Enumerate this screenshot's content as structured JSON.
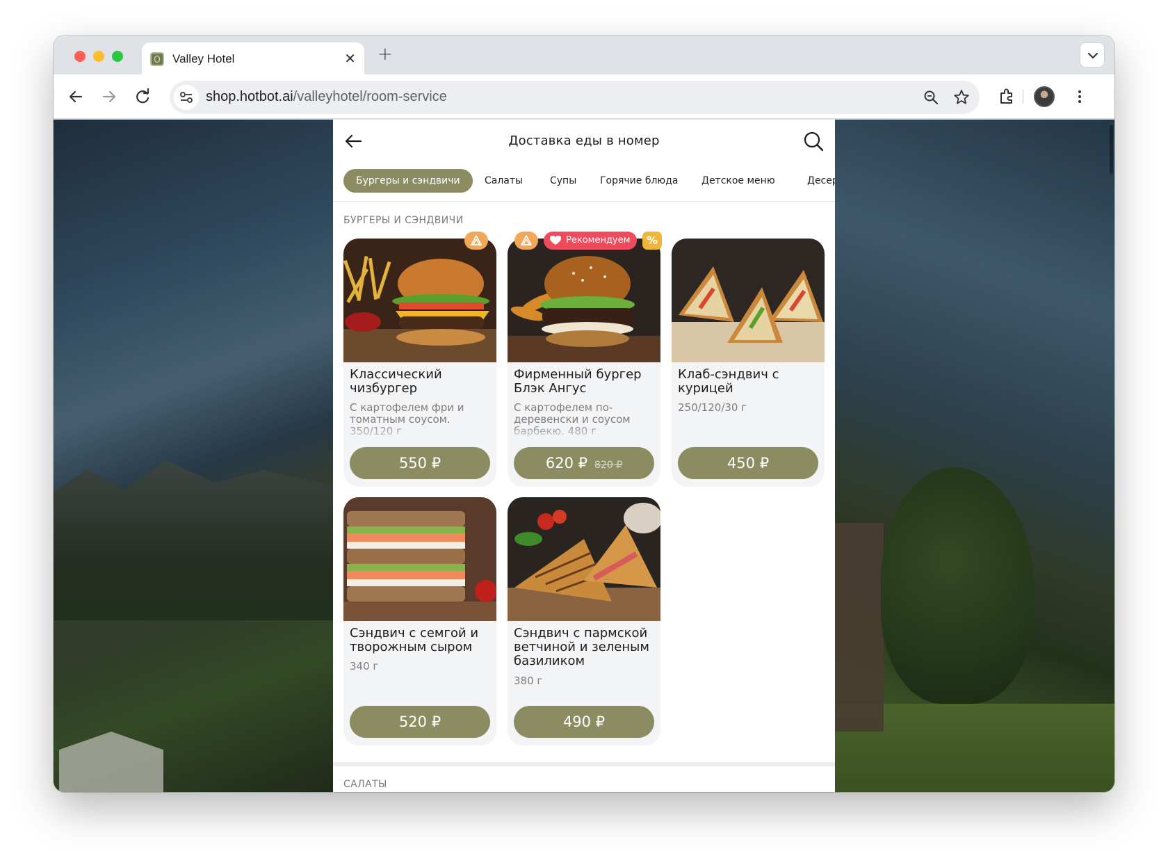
{
  "browser": {
    "tab_title": "Valley Hotel",
    "url_host": "shop.hotbot.ai",
    "url_path": "/valleyhotel/room-service"
  },
  "header": {
    "title": "Доставка еды в номер"
  },
  "categories": [
    {
      "label": "Бургеры и сэндвичи",
      "active": true
    },
    {
      "label": "Салаты",
      "active": false
    },
    {
      "label": "Супы",
      "active": false
    },
    {
      "label": "Горячие блюда",
      "active": false
    },
    {
      "label": "Детское меню",
      "active": false
    },
    {
      "label": "Десер",
      "active": false
    }
  ],
  "sections": [
    {
      "title": "БУРГЕРЫ И СЭНДВИЧИ",
      "items": [
        {
          "name": "Классический чизбургер",
          "desc": "С картофелем фри и томатным соусом. 350/120 г",
          "price": "550 ₽",
          "old_price": "",
          "badges": [
            "spicy"
          ]
        },
        {
          "name": "Фирменный бургер Блэк Ангус",
          "desc": "С картофелем по-деревенски и соусом барбекю. 480 г",
          "price": "620 ₽",
          "old_price": "820 ₽",
          "badges": [
            "spicy",
            "recommended",
            "sale"
          ]
        },
        {
          "name": "Клаб-сэндвич с курицей",
          "desc": "250/120/30 г",
          "price": "450 ₽",
          "old_price": "",
          "badges": []
        },
        {
          "name": "Сэндвич с семгой и творожным сыром",
          "desc": "340 г",
          "price": "520 ₽",
          "old_price": "",
          "badges": []
        },
        {
          "name": "Сэндвич с пармской ветчиной и зеленым базиликом",
          "desc": "380 г",
          "price": "490 ₽",
          "old_price": "",
          "badges": []
        }
      ]
    },
    {
      "title": "САЛАТЫ",
      "items": []
    }
  ],
  "badges": {
    "recommended": "Рекомендуем",
    "sale": "%"
  },
  "colors": {
    "accent": "#8b8c62",
    "recommend": "#f04a5d",
    "spicy": "#f0a757",
    "sale": "#f0b63a"
  },
  "icons": [
    "back-arrow-icon",
    "search-icon",
    "forward-arrow-icon",
    "reload-icon",
    "site-settings-icon",
    "zoom-icon",
    "bookmark-star-icon",
    "extensions-icon",
    "more-menu-icon",
    "heart-icon",
    "spicy-icon"
  ]
}
